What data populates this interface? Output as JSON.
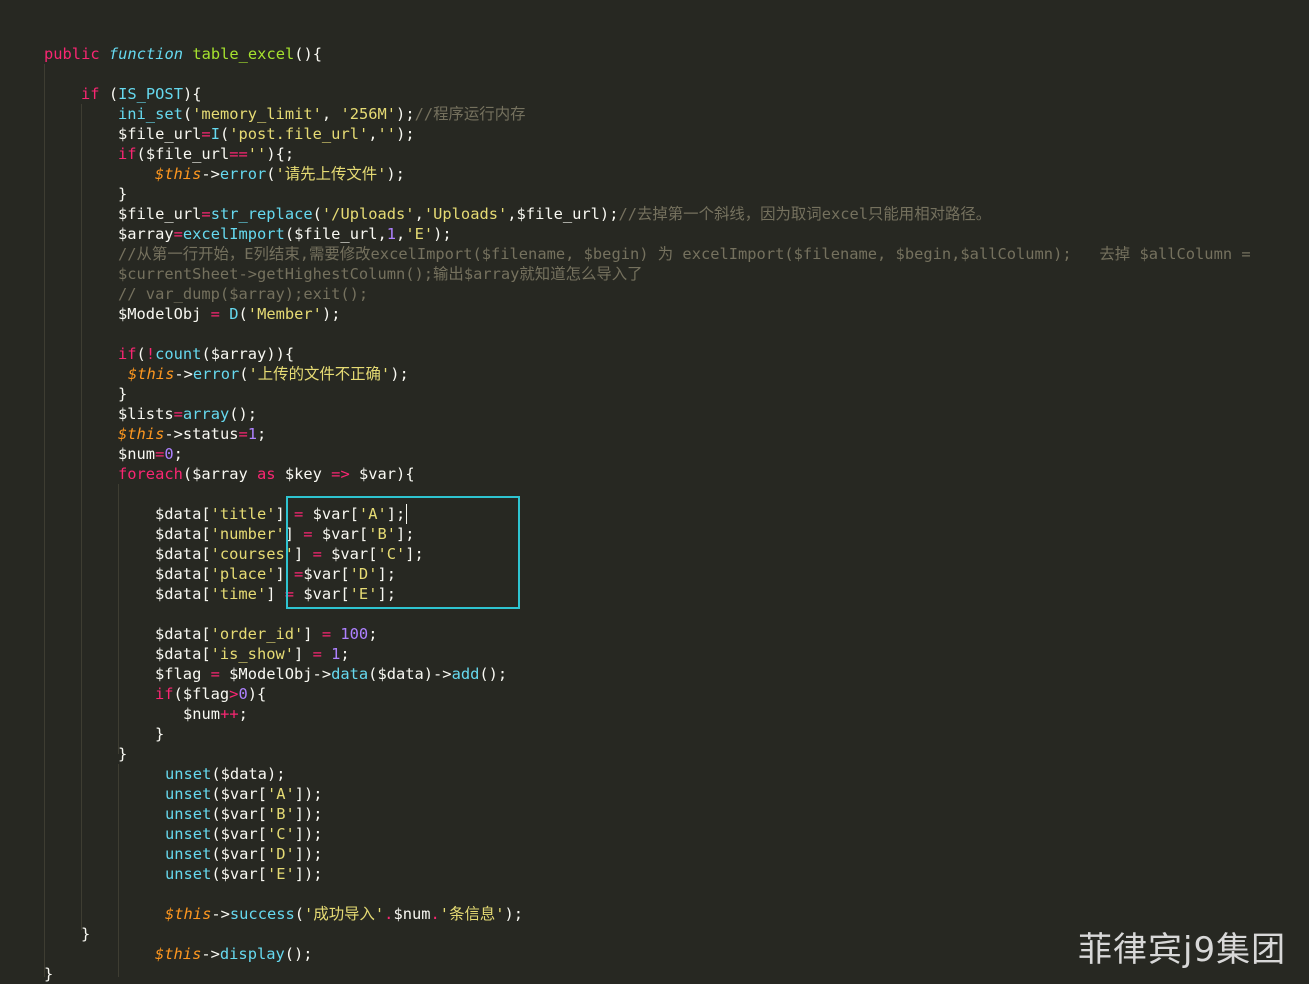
{
  "colors": {
    "background": "#272822",
    "keyword": "#F92672",
    "storage": "#66D9EF",
    "function": "#A6E22E",
    "string": "#E6DB74",
    "comment": "#75715E",
    "number": "#AE81FF",
    "variable_special": "#FD971F",
    "text": "#F8F8F2",
    "highlight_box": "#2EC4D1"
  },
  "code_lines": [
    [
      [
        "k",
        "public"
      ],
      [
        "p",
        " "
      ],
      [
        "ks",
        "function"
      ],
      [
        "p",
        " "
      ],
      [
        "f",
        "table_excel"
      ],
      [
        "p",
        "(){"
      ]
    ],
    [],
    [
      [
        "k",
        "if"
      ],
      [
        "p",
        " ("
      ],
      [
        "fc",
        "IS_POST"
      ],
      [
        "p",
        "){"
      ]
    ],
    [
      [
        "fc",
        "ini_set"
      ],
      [
        "p",
        "("
      ],
      [
        "s",
        "'memory_limit'"
      ],
      [
        "p",
        ", "
      ],
      [
        "s",
        "'256M'"
      ],
      [
        "p",
        ");"
      ],
      [
        "c",
        "//程序运行内存"
      ]
    ],
    [
      [
        "p",
        "$file_url"
      ],
      [
        "o",
        "="
      ],
      [
        "fc",
        "I"
      ],
      [
        "p",
        "("
      ],
      [
        "s",
        "'post.file_url'"
      ],
      [
        "p",
        ","
      ],
      [
        "s",
        "''"
      ],
      [
        "p",
        ");"
      ]
    ],
    [
      [
        "k",
        "if"
      ],
      [
        "p",
        "($file_url"
      ],
      [
        "o",
        "=="
      ],
      [
        "s",
        "''"
      ],
      [
        "p",
        "){;"
      ]
    ],
    [
      [
        "t",
        "$this"
      ],
      [
        "p",
        "->"
      ],
      [
        "fc",
        "error"
      ],
      [
        "p",
        "("
      ],
      [
        "s",
        "'请先上传文件'"
      ],
      [
        "p",
        ");"
      ]
    ],
    [
      [
        "p",
        "}"
      ]
    ],
    [
      [
        "p",
        "$file_url"
      ],
      [
        "o",
        "="
      ],
      [
        "fc",
        "str_replace"
      ],
      [
        "p",
        "("
      ],
      [
        "s",
        "'/Uploads'"
      ],
      [
        "p",
        ","
      ],
      [
        "s",
        "'Uploads'"
      ],
      [
        "p",
        ",$file_url);"
      ],
      [
        "c",
        "//去掉第一个斜线，因为取词excel只能用相对路径。"
      ]
    ],
    [
      [
        "p",
        "$array"
      ],
      [
        "o",
        "="
      ],
      [
        "fc",
        "excelImport"
      ],
      [
        "p",
        "($file_url,"
      ],
      [
        "n",
        "1"
      ],
      [
        "p",
        ","
      ],
      [
        "s",
        "'E'"
      ],
      [
        "p",
        ");"
      ]
    ],
    [
      [
        "c",
        "//从第一行开始，E列结束,需要修改excelImport($filename, $begin) 为 excelImport($filename, $begin,$allColumn);   去掉 $allColumn ="
      ]
    ],
    [
      [
        "c",
        "$currentSheet->getHighestColumn();输出$array就知道怎么导入了"
      ]
    ],
    [
      [
        "c",
        "// var_dump($array);exit();"
      ]
    ],
    [
      [
        "p",
        "$ModelObj "
      ],
      [
        "o",
        "="
      ],
      [
        "p",
        " "
      ],
      [
        "fc",
        "D"
      ],
      [
        "p",
        "("
      ],
      [
        "s",
        "'Member'"
      ],
      [
        "p",
        ");"
      ]
    ],
    [],
    [
      [
        "k",
        "if"
      ],
      [
        "p",
        "("
      ],
      [
        "o",
        "!"
      ],
      [
        "fc",
        "count"
      ],
      [
        "p",
        "($array)){"
      ]
    ],
    [
      [
        "t",
        "$this"
      ],
      [
        "p",
        "->"
      ],
      [
        "fc",
        "error"
      ],
      [
        "p",
        "("
      ],
      [
        "s",
        "'上传的文件不正确'"
      ],
      [
        "p",
        ");"
      ]
    ],
    [
      [
        "p",
        "}"
      ]
    ],
    [
      [
        "p",
        "$lists"
      ],
      [
        "o",
        "="
      ],
      [
        "fc",
        "array"
      ],
      [
        "p",
        "();"
      ]
    ],
    [
      [
        "t",
        "$this"
      ],
      [
        "p",
        "->status"
      ],
      [
        "o",
        "="
      ],
      [
        "n",
        "1"
      ],
      [
        "p",
        ";"
      ]
    ],
    [
      [
        "p",
        "$num"
      ],
      [
        "o",
        "="
      ],
      [
        "n",
        "0"
      ],
      [
        "p",
        ";"
      ]
    ],
    [
      [
        "k",
        "foreach"
      ],
      [
        "p",
        "($array "
      ],
      [
        "k",
        "as"
      ],
      [
        "p",
        " $key "
      ],
      [
        "o",
        "=>"
      ],
      [
        "p",
        " $var){"
      ]
    ],
    [],
    [
      [
        "p",
        "$data["
      ],
      [
        "s",
        "'title'"
      ],
      [
        "p",
        "] "
      ],
      [
        "o",
        "="
      ],
      [
        "p",
        " $var["
      ],
      [
        "s",
        "'A'"
      ],
      [
        "p",
        "];"
      ]
    ],
    [
      [
        "p",
        "$data["
      ],
      [
        "s",
        "'number'"
      ],
      [
        "p",
        "] "
      ],
      [
        "o",
        "="
      ],
      [
        "p",
        " $var["
      ],
      [
        "s",
        "'B'"
      ],
      [
        "p",
        "];"
      ]
    ],
    [
      [
        "p",
        "$data["
      ],
      [
        "s",
        "'courses'"
      ],
      [
        "p",
        "] "
      ],
      [
        "o",
        "="
      ],
      [
        "p",
        " $var["
      ],
      [
        "s",
        "'C'"
      ],
      [
        "p",
        "];"
      ]
    ],
    [
      [
        "p",
        "$data["
      ],
      [
        "s",
        "'place'"
      ],
      [
        "p",
        "] "
      ],
      [
        "o",
        "="
      ],
      [
        "p",
        "$var["
      ],
      [
        "s",
        "'D'"
      ],
      [
        "p",
        "];"
      ]
    ],
    [
      [
        "p",
        "$data["
      ],
      [
        "s",
        "'time'"
      ],
      [
        "p",
        "] "
      ],
      [
        "o",
        "="
      ],
      [
        "p",
        " $var["
      ],
      [
        "s",
        "'E'"
      ],
      [
        "p",
        "];"
      ]
    ],
    [],
    [
      [
        "p",
        "$data["
      ],
      [
        "s",
        "'order_id'"
      ],
      [
        "p",
        "] "
      ],
      [
        "o",
        "="
      ],
      [
        "p",
        " "
      ],
      [
        "n",
        "100"
      ],
      [
        "p",
        ";"
      ]
    ],
    [
      [
        "p",
        "$data["
      ],
      [
        "s",
        "'is_show'"
      ],
      [
        "p",
        "] "
      ],
      [
        "o",
        "="
      ],
      [
        "p",
        " "
      ],
      [
        "n",
        "1"
      ],
      [
        "p",
        ";"
      ]
    ],
    [
      [
        "p",
        "$flag "
      ],
      [
        "o",
        "="
      ],
      [
        "p",
        " $ModelObj->"
      ],
      [
        "fc",
        "data"
      ],
      [
        "p",
        "($data)->"
      ],
      [
        "fc",
        "add"
      ],
      [
        "p",
        "();"
      ]
    ],
    [
      [
        "k",
        "if"
      ],
      [
        "p",
        "($flag"
      ],
      [
        "o",
        ">"
      ],
      [
        "n",
        "0"
      ],
      [
        "p",
        "){"
      ]
    ],
    [
      [
        "p",
        "$num"
      ],
      [
        "o",
        "++"
      ],
      [
        "p",
        ";"
      ]
    ],
    [
      [
        "p",
        "}"
      ]
    ],
    [
      [
        "p",
        "}"
      ]
    ],
    [
      [
        "fc",
        "unset"
      ],
      [
        "p",
        "($data);"
      ]
    ],
    [
      [
        "fc",
        "unset"
      ],
      [
        "p",
        "($var["
      ],
      [
        "s",
        "'A'"
      ],
      [
        "p",
        "]);"
      ]
    ],
    [
      [
        "fc",
        "unset"
      ],
      [
        "p",
        "($var["
      ],
      [
        "s",
        "'B'"
      ],
      [
        "p",
        "]);"
      ]
    ],
    [
      [
        "fc",
        "unset"
      ],
      [
        "p",
        "($var["
      ],
      [
        "s",
        "'C'"
      ],
      [
        "p",
        "]);"
      ]
    ],
    [
      [
        "fc",
        "unset"
      ],
      [
        "p",
        "($var["
      ],
      [
        "s",
        "'D'"
      ],
      [
        "p",
        "]);"
      ]
    ],
    [
      [
        "fc",
        "unset"
      ],
      [
        "p",
        "($var["
      ],
      [
        "s",
        "'E'"
      ],
      [
        "p",
        "]);"
      ]
    ],
    [],
    [
      [
        "t",
        "$this"
      ],
      [
        "p",
        "->"
      ],
      [
        "fc",
        "success"
      ],
      [
        "p",
        "("
      ],
      [
        "s",
        "'成功导入'"
      ],
      [
        "o",
        "."
      ],
      [
        "p",
        "$num"
      ],
      [
        "o",
        "."
      ],
      [
        "s",
        "'条信息'"
      ],
      [
        "p",
        ");"
      ]
    ],
    [
      [
        "p",
        "}"
      ]
    ],
    [
      [
        "t",
        "$this"
      ],
      [
        "p",
        "->"
      ],
      [
        "fc",
        "display"
      ],
      [
        "p",
        "();"
      ]
    ],
    [
      [
        "p",
        "}"
      ]
    ]
  ],
  "watermark": "菲律宾j9集团"
}
